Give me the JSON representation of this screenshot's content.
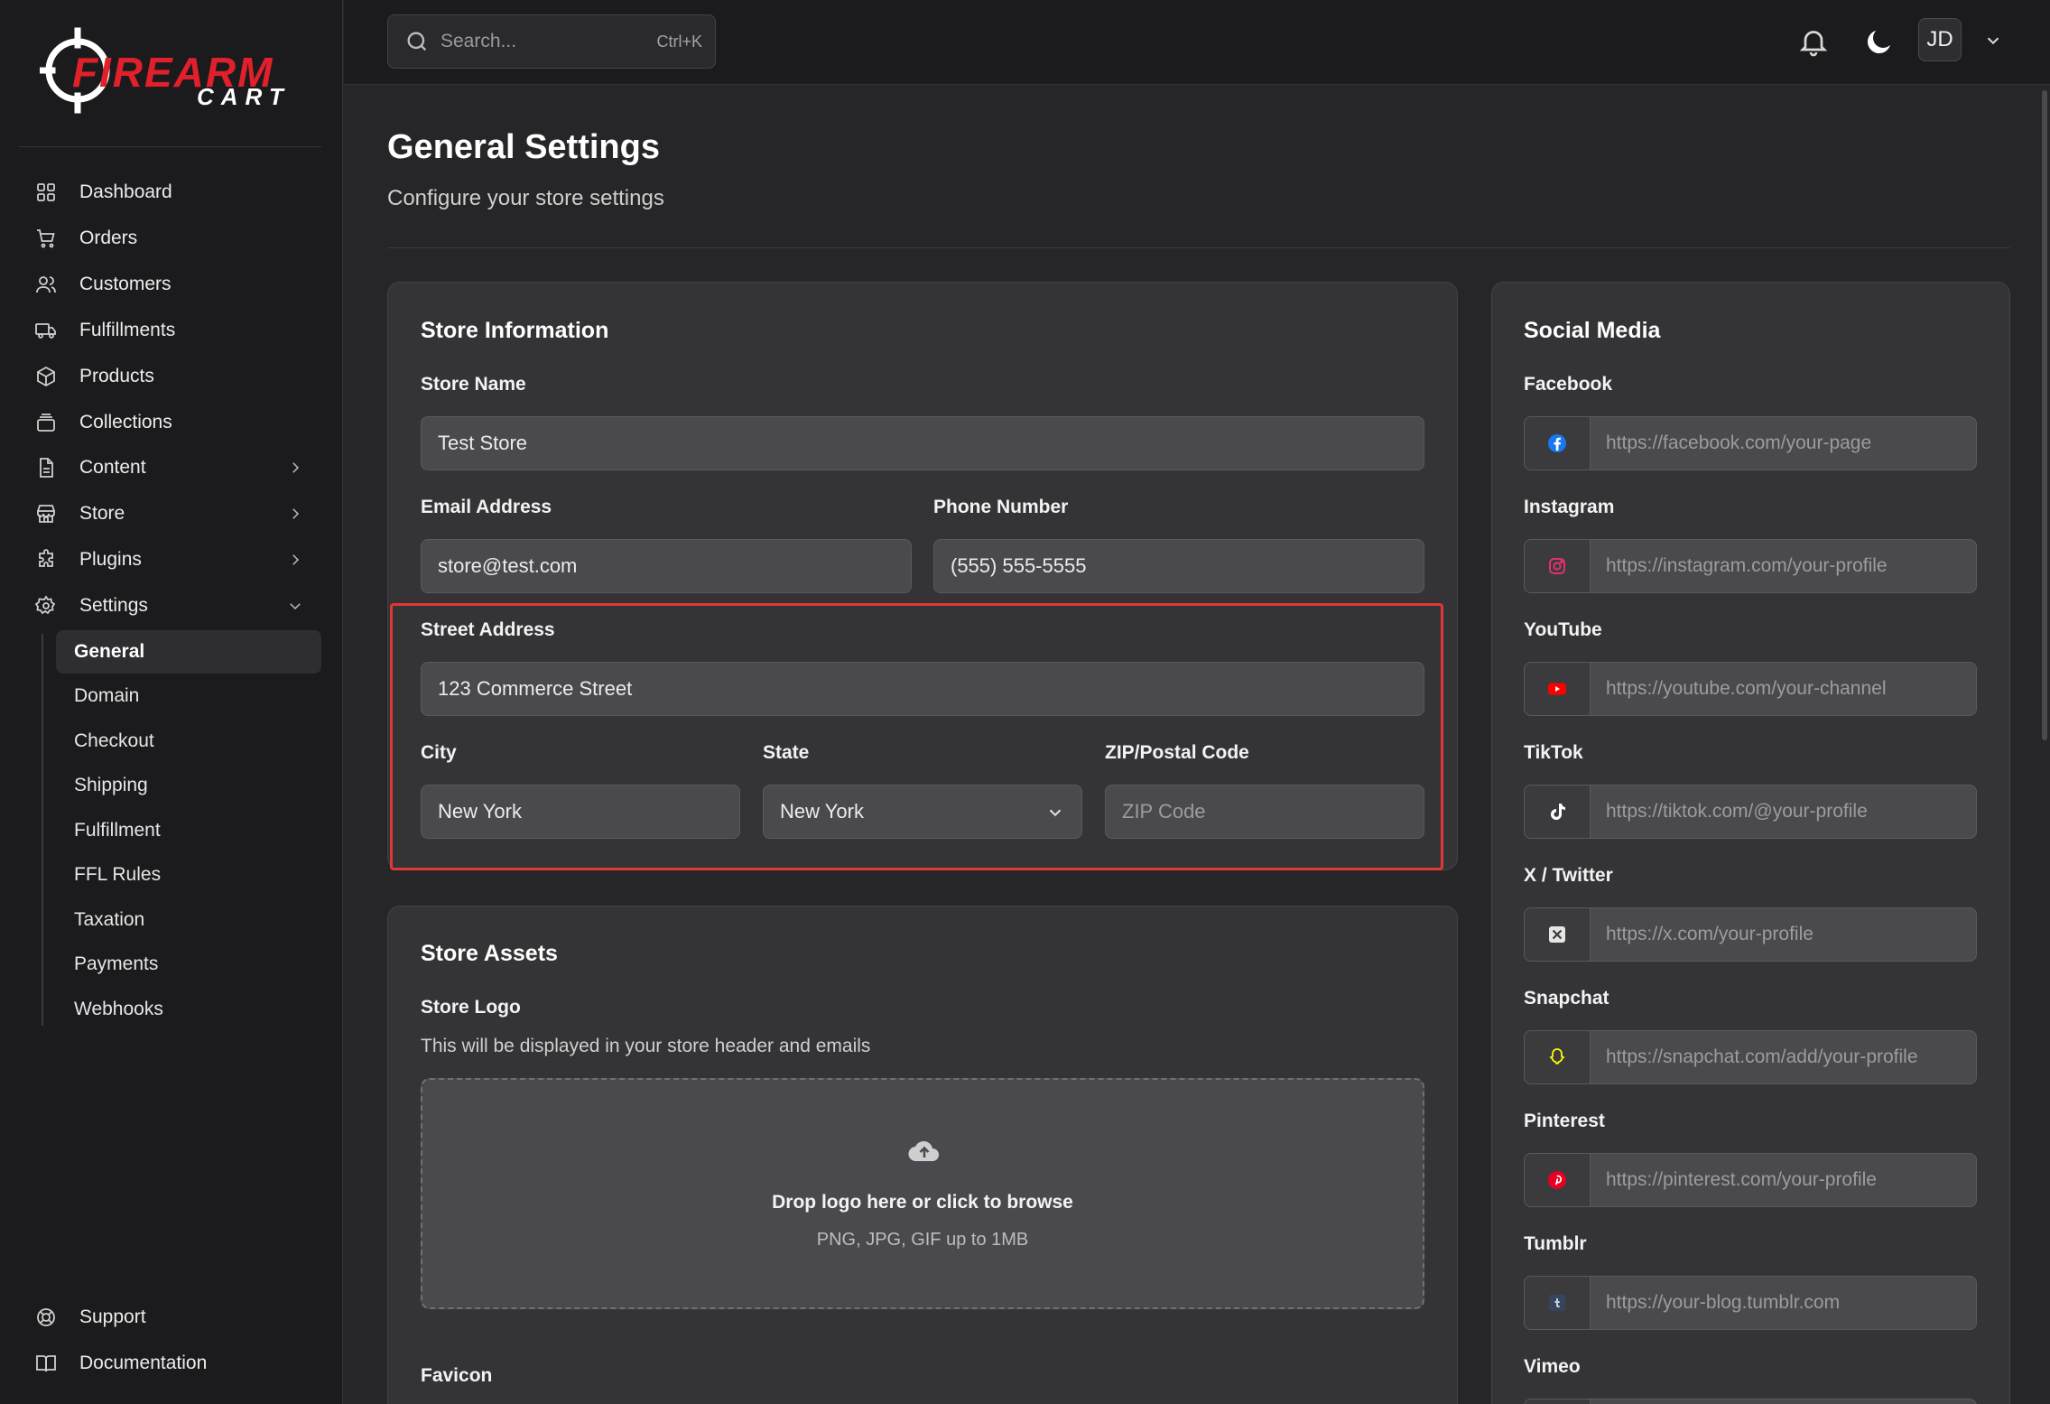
{
  "brand": {
    "logo_line1": "FIREARM",
    "logo_line2": "CART"
  },
  "search": {
    "placeholder": "Search...",
    "shortcut": "Ctrl+K"
  },
  "user": {
    "initials": "JD"
  },
  "sidebar": {
    "items": [
      {
        "label": "Dashboard",
        "icon": "dashboard-icon"
      },
      {
        "label": "Orders",
        "icon": "cart-icon"
      },
      {
        "label": "Customers",
        "icon": "users-icon"
      },
      {
        "label": "Fulfillments",
        "icon": "truck-icon"
      },
      {
        "label": "Products",
        "icon": "box-icon"
      },
      {
        "label": "Collections",
        "icon": "collection-icon"
      },
      {
        "label": "Content",
        "icon": "file-icon",
        "expandable": true
      },
      {
        "label": "Store",
        "icon": "store-icon",
        "expandable": true
      },
      {
        "label": "Plugins",
        "icon": "puzzle-icon",
        "expandable": true
      },
      {
        "label": "Settings",
        "icon": "gear-icon",
        "expanded": true
      }
    ],
    "settings_sub": [
      "General",
      "Domain",
      "Checkout",
      "Shipping",
      "Fulfillment",
      "FFL Rules",
      "Taxation",
      "Payments",
      "Webhooks"
    ],
    "active_sub": "General",
    "footer": [
      {
        "label": "Support",
        "icon": "lifebuoy-icon"
      },
      {
        "label": "Documentation",
        "icon": "book-icon"
      }
    ]
  },
  "page": {
    "title": "General Settings",
    "subtitle": "Configure your store settings"
  },
  "store_info": {
    "title": "Store Information",
    "store_name_label": "Store Name",
    "store_name": "Test Store",
    "email_label": "Email Address",
    "email": "store@test.com",
    "phone_label": "Phone Number",
    "phone": "(555) 555-5555",
    "street_label": "Street Address",
    "street": "123 Commerce Street",
    "city_label": "City",
    "city": "New York",
    "state_label": "State",
    "state": "New York",
    "zip_label": "ZIP/Postal Code",
    "zip_placeholder": "ZIP Code"
  },
  "store_assets": {
    "title": "Store Assets",
    "logo_label": "Store Logo",
    "logo_help": "This will be displayed in your store header and emails",
    "drop_title": "Drop logo here or click to browse",
    "drop_sub": "PNG, JPG, GIF up to 1MB",
    "favicon_label": "Favicon"
  },
  "social": {
    "title": "Social Media",
    "items": [
      {
        "label": "Facebook",
        "placeholder": "https://facebook.com/your-page",
        "icon": "facebook-icon",
        "color": "#1877f2"
      },
      {
        "label": "Instagram",
        "placeholder": "https://instagram.com/your-profile",
        "icon": "instagram-icon",
        "color": "#e1306c"
      },
      {
        "label": "YouTube",
        "placeholder": "https://youtube.com/your-channel",
        "icon": "youtube-icon",
        "color": "#ff0000"
      },
      {
        "label": "TikTok",
        "placeholder": "https://tiktok.com/@your-profile",
        "icon": "tiktok-icon",
        "color": "#ffffff"
      },
      {
        "label": "X / Twitter",
        "placeholder": "https://x.com/your-profile",
        "icon": "x-icon",
        "color": "#ffffff"
      },
      {
        "label": "Snapchat",
        "placeholder": "https://snapchat.com/add/your-profile",
        "icon": "snapchat-icon",
        "color": "#fffc00"
      },
      {
        "label": "Pinterest",
        "placeholder": "https://pinterest.com/your-profile",
        "icon": "pinterest-icon",
        "color": "#e60023"
      },
      {
        "label": "Tumblr",
        "placeholder": "https://your-blog.tumblr.com",
        "icon": "tumblr-icon",
        "color": "#35465c"
      },
      {
        "label": "Vimeo",
        "placeholder": "",
        "icon": "vimeo-icon",
        "color": "#1ab7ea"
      }
    ]
  },
  "colors": {
    "accent": "#e0202a",
    "highlight": "#e23636",
    "sidebar_bg": "#1b1b1d",
    "card_bg": "#343437"
  }
}
